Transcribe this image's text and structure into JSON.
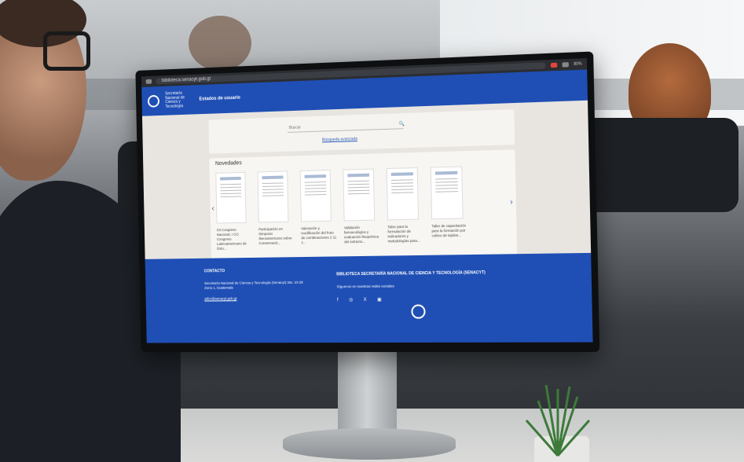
{
  "browser": {
    "url": "biblioteca.senacyt.gob.gt",
    "zoom": "80%"
  },
  "site": {
    "logo_text": "Secretaría\nNacional de\nCiencia y\nTecnología",
    "nav_link": "Estados de usuario"
  },
  "search": {
    "placeholder": "Buscar",
    "advanced_link": "Búsqueda avanzada"
  },
  "news": {
    "title": "Novedades",
    "items": [
      {
        "caption": "XII Congreso Nacional, I CO Congreso Latinoamericano de Estu..."
      },
      {
        "caption": "Participación en Simposio Iberoamericano sobre Conservació..."
      },
      {
        "caption": "Valoración y modificación del fruto de combinaciones 2 11 1..."
      },
      {
        "caption": "Validación farmacológica y evaluación fitoquímica del extracto..."
      },
      {
        "caption": "Taller para la formulación de indicadores y metodologías para..."
      },
      {
        "caption": "Taller de capacitación para la formación por cultivo de tejidos..."
      }
    ],
    "left_arrow": "‹",
    "right_arrow": "›",
    "dots": "● ● ●"
  },
  "footer": {
    "contact_heading": "CONTACTO",
    "address": "Secretaría Nacional de Ciencia y Tecnología (Senacyt) 3av. 13-28 Zona 1, Guatemala",
    "email": "jafcc@senacyt.gob.gt",
    "library_heading": "BIBLIOTECA SECRETARÍA NACIONAL DE CIENCIA Y TECNOLOGÍA (SENACYT)",
    "social_text": "Síguenos en nuestras redes sociales",
    "social_icons": "f ◎ X ▣"
  },
  "colors": {
    "brand_blue": "#1f4fb5"
  }
}
